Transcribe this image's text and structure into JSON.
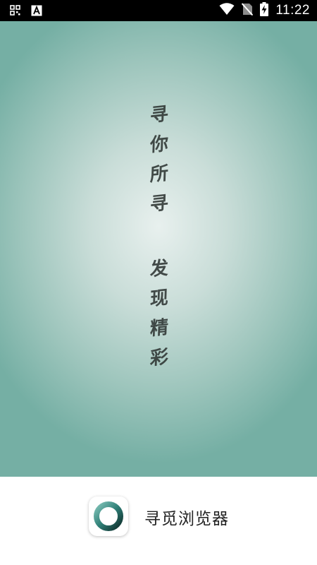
{
  "status_bar": {
    "time": "11:22",
    "icons": [
      "app-grid-icon",
      "keyboard-a-icon",
      "wifi-icon",
      "no-sim-icon",
      "battery-charging-icon"
    ]
  },
  "splash": {
    "slogan_column_1": [
      "寻",
      "你",
      "所",
      "寻"
    ],
    "slogan_column_2": [
      "发",
      "现",
      "精",
      "彩"
    ]
  },
  "footer": {
    "app_icon": "browser-ring-logo-icon",
    "app_name": "寻觅浏览器"
  },
  "colors": {
    "status_bar_bg": "#000000",
    "splash_center": "#e8f0ee",
    "splash_edge": "#75afa4",
    "slogan_text": "#2e3533",
    "footer_bg": "#ffffff"
  }
}
